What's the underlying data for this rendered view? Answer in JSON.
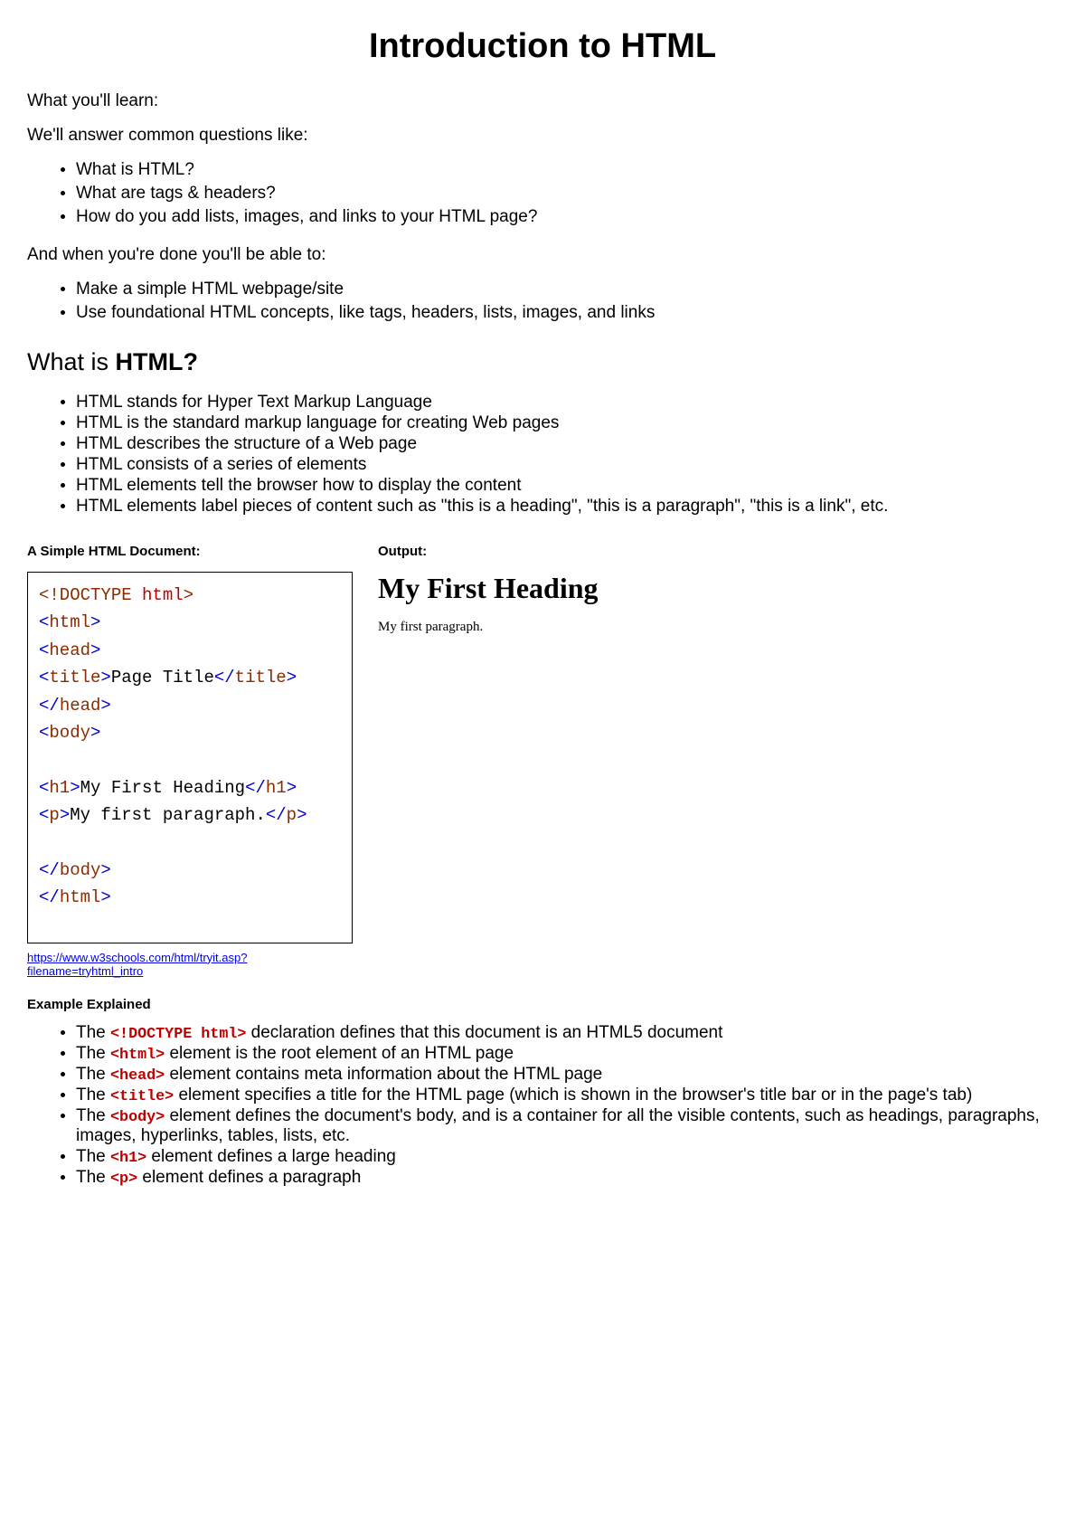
{
  "title": "Introduction to HTML",
  "intro1": "What you'll learn:",
  "intro2": "We'll answer common questions like:",
  "questions": [
    "What is HTML?",
    "What are tags & headers?",
    "How do you add lists, images, and links to your HTML page?"
  ],
  "intro3": "And when you're done you'll be able to:",
  "outcomes": [
    "Make a simple HTML webpage/site",
    "Use foundational HTML concepts, like tags, headers, lists, images, and links"
  ],
  "section_heading_prefix": "What is ",
  "section_heading_bold": "HTML?",
  "facts": [
    "HTML stands for Hyper Text Markup Language",
    "HTML is the standard markup language for creating Web pages",
    "HTML describes the structure of a Web page",
    "HTML consists of a series of elements",
    "HTML elements tell the browser how to display the content",
    "HTML elements label pieces of content such as \"this is a heading\", \"this is a paragraph\", \"this is a link\", etc."
  ],
  "code_label": "A Simple HTML Document:",
  "output_label": "Output:",
  "code": {
    "l1a": "<!DOCTYPE ",
    "l1b": "html",
    "l1c": ">",
    "l2a": "<",
    "l2b": "html",
    "l2c": ">",
    "l3a": "<",
    "l3b": "head",
    "l3c": ">",
    "l4a": "<",
    "l4b": "title",
    "l4c": ">",
    "l4txt": "Page Title",
    "l4d": "</",
    "l4e": "title",
    "l4f": ">",
    "l5a": "</",
    "l5b": "head",
    "l5c": ">",
    "l6a": "<",
    "l6b": "body",
    "l6c": ">",
    "l7a": "<",
    "l7b": "h1",
    "l7c": ">",
    "l7txt": "My First Heading",
    "l7d": "</",
    "l7e": "h1",
    "l7f": ">",
    "l8a": "<",
    "l8b": "p",
    "l8c": ">",
    "l8txt": "My first paragraph.",
    "l8d": "</",
    "l8e": "p",
    "l8f": ">",
    "l9a": "</",
    "l9b": "body",
    "l9c": ">",
    "l10a": "</",
    "l10b": "html",
    "l10c": ">"
  },
  "output": {
    "heading": "My First Heading",
    "paragraph": "My first paragraph."
  },
  "link_text": "https://www.w3schools.com/html/tryit.asp?filename=tryhtml_intro",
  "explained_label": "Example Explained",
  "explained": [
    {
      "pre": "The ",
      "code": "<!DOCTYPE html>",
      "post": " declaration defines that this document is an HTML5 document"
    },
    {
      "pre": "The ",
      "code": "<html>",
      "post": " element is the root element of an HTML page"
    },
    {
      "pre": "The ",
      "code": "<head>",
      "post": " element contains meta information about the HTML page"
    },
    {
      "pre": "The ",
      "code": "<title>",
      "post": " element specifies a title for the HTML page (which is shown in the browser's title bar or in the page's tab)"
    },
    {
      "pre": "The ",
      "code": "<body>",
      "post": " element defines the document's body, and is a container for all the visible contents, such as headings, paragraphs, images, hyperlinks, tables, lists, etc."
    },
    {
      "pre": "The ",
      "code": "<h1>",
      "post": " element defines a large heading"
    },
    {
      "pre": "The ",
      "code": "<p>",
      "post": " element defines a paragraph"
    }
  ]
}
